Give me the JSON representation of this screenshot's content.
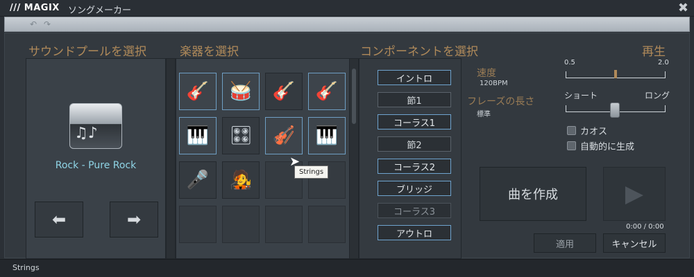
{
  "window": {
    "logo": "/// MAGIX",
    "title": "ソングメーカー",
    "close_glyph": "✖"
  },
  "toolbar": {
    "undo_glyph": "↶",
    "redo_glyph": "↷"
  },
  "sound_pool": {
    "heading": "サウンドプールを選択",
    "selected": "Rock - Pure Rock",
    "prev_glyph": "⬅",
    "next_glyph": "➡"
  },
  "instruments": {
    "heading": "楽器を選択",
    "slots": [
      {
        "icon": "🎸",
        "name": "electric-guitar"
      },
      {
        "icon": "🥁",
        "name": "drum-kit"
      },
      {
        "icon": "🎸",
        "name": "acoustic-guitar"
      },
      {
        "icon": "🎸",
        "name": "acoustic-guitar-2"
      },
      {
        "icon": "🎹",
        "name": "piano"
      },
      {
        "icon": "🎛",
        "name": "synthesizer"
      },
      {
        "icon": "🎻",
        "name": "strings"
      },
      {
        "icon": "🎹",
        "name": "keyboard"
      },
      {
        "icon": "🎤",
        "name": "microphone"
      },
      {
        "icon": "🧑‍🎤",
        "name": "vocalist"
      }
    ],
    "tooltip": "Strings"
  },
  "components": {
    "heading": "コンポーネントを選択",
    "items": [
      {
        "label": "イントロ",
        "state": "sel"
      },
      {
        "label": "節1",
        "state": "unsel"
      },
      {
        "label": "コーラス1",
        "state": "sel"
      },
      {
        "label": "節2",
        "state": "unsel"
      },
      {
        "label": "コーラス2",
        "state": "sel"
      },
      {
        "label": "ブリッジ",
        "state": "sel"
      },
      {
        "label": "コーラス3",
        "state": "dim"
      },
      {
        "label": "アウトロ",
        "state": "sel"
      }
    ]
  },
  "playback": {
    "heading": "再生",
    "speed_label": "速度",
    "speed_value": "120BPM",
    "speed_min": "0.5",
    "speed_max": "2.0",
    "phrase_label": "フレーズの長さ",
    "phrase_value": "標準",
    "phrase_short": "ショート",
    "phrase_long": "ロング",
    "chaos_label": "カオス",
    "auto_label": "自動的に生成",
    "create_label": "曲を作成",
    "play_glyph": "▶",
    "time": "0:00  / 0:00",
    "apply_label": "適用",
    "cancel_label": "キャンセル"
  },
  "status": {
    "text": "Strings"
  },
  "colors": {
    "accent_gold": "#b08a5a",
    "select_blue": "#6fa4cf",
    "pool_text": "#8fd4e6"
  }
}
